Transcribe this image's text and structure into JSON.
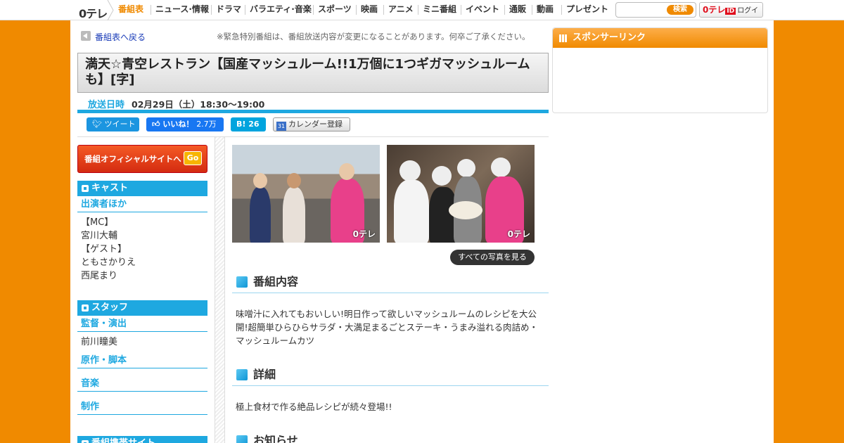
{
  "nav": {
    "logo": "0テレ",
    "items": [
      "番組表",
      "ニュース·情報",
      "ドラマ",
      "バラエティ·音楽",
      "スポーツ",
      "映画",
      "アニメ",
      "ミニ番組",
      "イベント",
      "通販",
      "動画",
      "プレゼント"
    ],
    "active": "番組表",
    "search_placeholder": "",
    "search_button": "検索",
    "login_logo": "0テレ",
    "login_id": "ID",
    "login_label": "ログイン"
  },
  "back": {
    "label": "番組表へ戻る",
    "notice": "※緊急特別番組は、番組放送内容が変更になることがあります。何卒ご了承ください。"
  },
  "program": {
    "title": "満天☆青空レストラン【国産マッシュルーム!!1万個に1つギガマッシュルームも】[字]",
    "airdate_label": "放送日時",
    "airdate": "02月29日（土）18:30～19:00"
  },
  "social": {
    "tweet": "ツイート",
    "like": "いいね！",
    "like_count": "2.7万",
    "hatena_count": "26",
    "hatena_label": "B!",
    "calendar": "カレンダー登録",
    "calendar_icon": "31"
  },
  "sidebar": {
    "official_label": "番組オフィシャルサイトへ",
    "official_go": "Go",
    "cast": {
      "header": "キャスト",
      "sub": "出演者ほか",
      "lines": [
        "【MC】",
        "宮川大輔",
        "【ゲスト】",
        "ともさかりえ",
        "西尾まり"
      ]
    },
    "staff": {
      "header": "スタッフ",
      "director_label": "監督・演出",
      "director": "前川瞳美",
      "writer_label": "原作・脚本",
      "music_label": "音楽",
      "production_label": "制作"
    },
    "related_header": "番組携帯サイト"
  },
  "photos": {
    "watermark": "0テレ",
    "all_photos": "すべての写真を見る"
  },
  "content": {
    "summary_header": "番組内容",
    "summary_text": "味噌汁に入れてもおいしい!明日作って欲しいマッシュルームのレシピを大公開!超簡単ひらひらサラダ・大満足まるごとステーキ・うまみ溢れる肉詰め・マッシュルームカツ",
    "detail_header": "詳細",
    "detail_text": "極上食材で作る絶品レシピが続々登場!!",
    "news_header": "お知らせ"
  },
  "sponsor": {
    "header": "スポンサーリンク"
  },
  "colors": {
    "brand_orange": "#f08a00",
    "accent_blue": "#1ea8e0"
  }
}
